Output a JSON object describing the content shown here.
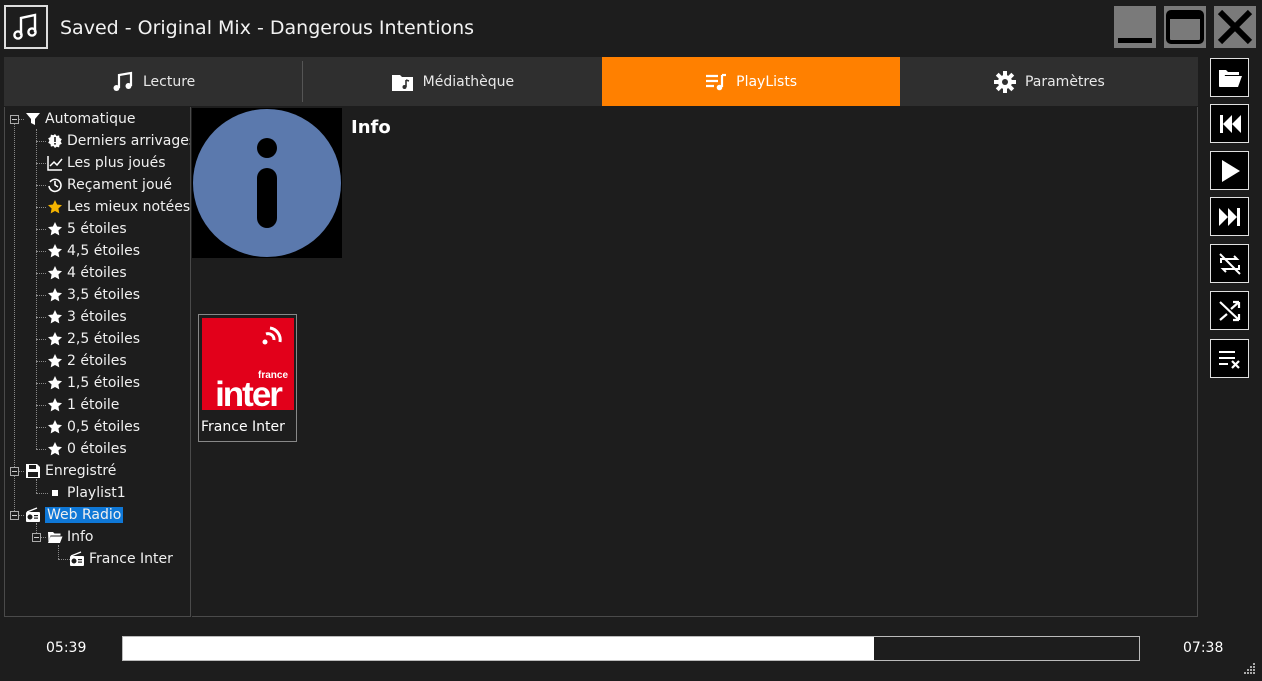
{
  "window": {
    "title": "Saved - Original Mix - Dangerous Intentions",
    "app_icon": "music-note-icon",
    "controls": [
      "minimize-icon",
      "maximize-icon",
      "close-icon"
    ]
  },
  "tabs": [
    {
      "label": "Lecture",
      "icon": "music-note-icon",
      "active": false
    },
    {
      "label": "Médiathèque",
      "icon": "music-folder-icon",
      "active": false
    },
    {
      "label": "PlayLists",
      "icon": "playlist-icon",
      "active": true
    },
    {
      "label": "Paramètres",
      "icon": "gear-icon",
      "active": false
    }
  ],
  "tree": {
    "automatique": {
      "label": "Automatique",
      "items": [
        {
          "label": "Derniers arrivages",
          "icon": "new-badge-icon"
        },
        {
          "label": "Les plus joués",
          "icon": "chart-line-icon"
        },
        {
          "label": "Reçament joué",
          "icon": "history-icon"
        },
        {
          "label": "Les mieux notées",
          "icon": "star-gold-icon"
        },
        {
          "label": "5 étoiles",
          "icon": "star-icon"
        },
        {
          "label": "4,5 étoiles",
          "icon": "star-icon"
        },
        {
          "label": "4 étoiles",
          "icon": "star-icon"
        },
        {
          "label": "3,5 étoiles",
          "icon": "star-icon"
        },
        {
          "label": "3 étoiles",
          "icon": "star-icon"
        },
        {
          "label": "2,5 étoiles",
          "icon": "star-icon"
        },
        {
          "label": "2 étoiles",
          "icon": "star-icon"
        },
        {
          "label": "1,5 étoiles",
          "icon": "star-icon"
        },
        {
          "label": "1 étoile",
          "icon": "star-icon"
        },
        {
          "label": "0,5 étoiles",
          "icon": "star-icon"
        },
        {
          "label": "0 étoiles",
          "icon": "star-icon"
        }
      ]
    },
    "enregistre": {
      "label": "Enregistré",
      "items": [
        {
          "label": "Playlist1"
        }
      ]
    },
    "web_radio": {
      "label": "Web Radio",
      "selected": true,
      "info": {
        "label": "Info",
        "items": [
          {
            "label": "France Inter"
          }
        ]
      }
    }
  },
  "content": {
    "heading": "Info",
    "tile_icon": "info-icon",
    "stations": [
      {
        "label": "France Inter",
        "logo_small": "france",
        "logo_big": "inter"
      }
    ]
  },
  "controls": [
    "open-folder-icon",
    "previous-icon",
    "play-icon",
    "next-icon",
    "repeat-off-icon",
    "shuffle-icon",
    "clear-playlist-icon"
  ],
  "player": {
    "elapsed": "05:39",
    "total": "07:38",
    "progress": 0.739
  },
  "colors": {
    "background": "#1d1d1d",
    "accent": "#ff8000",
    "selection": "#0f78d7",
    "info_circle": "#5b79ad",
    "station_red": "#e2001a"
  }
}
